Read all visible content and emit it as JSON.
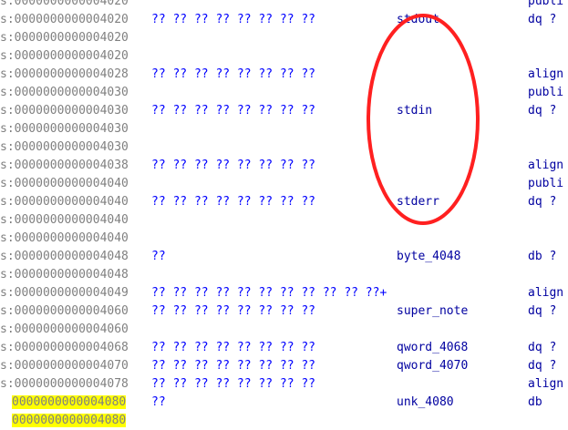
{
  "rows": [
    {
      "seg": "s",
      "addr": "0000000000004020",
      "bytes": "",
      "label": "",
      "type": "publi",
      "operand": ""
    },
    {
      "seg": "s",
      "addr": "0000000000004020",
      "bytes": "?? ?? ?? ?? ?? ?? ?? ??",
      "label": "stdout",
      "type": "dq",
      "operand": "?"
    },
    {
      "seg": "s",
      "addr": "0000000000004020",
      "bytes": "",
      "label": "",
      "type": "",
      "operand": ""
    },
    {
      "seg": "s",
      "addr": "0000000000004020",
      "bytes": "",
      "label": "",
      "type": "",
      "operand": ""
    },
    {
      "seg": "s",
      "addr": "0000000000004028",
      "bytes": "?? ?? ?? ?? ?? ?? ?? ??",
      "label": "",
      "type": "align",
      "operand": ""
    },
    {
      "seg": "s",
      "addr": "0000000000004030",
      "bytes": "",
      "label": "",
      "type": "publi",
      "operand": ""
    },
    {
      "seg": "s",
      "addr": "0000000000004030",
      "bytes": "?? ?? ?? ?? ?? ?? ?? ??",
      "label": "stdin",
      "type": "dq",
      "operand": "?"
    },
    {
      "seg": "s",
      "addr": "0000000000004030",
      "bytes": "",
      "label": "",
      "type": "",
      "operand": ""
    },
    {
      "seg": "s",
      "addr": "0000000000004030",
      "bytes": "",
      "label": "",
      "type": "",
      "operand": ""
    },
    {
      "seg": "s",
      "addr": "0000000000004038",
      "bytes": "?? ?? ?? ?? ?? ?? ?? ??",
      "label": "",
      "type": "align",
      "operand": ""
    },
    {
      "seg": "s",
      "addr": "0000000000004040",
      "bytes": "",
      "label": "",
      "type": "publi",
      "operand": ""
    },
    {
      "seg": "s",
      "addr": "0000000000004040",
      "bytes": "?? ?? ?? ?? ?? ?? ?? ??",
      "label": "stderr",
      "type": "dq",
      "operand": "?"
    },
    {
      "seg": "s",
      "addr": "0000000000004040",
      "bytes": "",
      "label": "",
      "type": "",
      "operand": ""
    },
    {
      "seg": "s",
      "addr": "0000000000004040",
      "bytes": "",
      "label": "",
      "type": "",
      "operand": ""
    },
    {
      "seg": "s",
      "addr": "0000000000004048",
      "bytes": "??",
      "label": "byte_4048",
      "type": "db",
      "operand": "?"
    },
    {
      "seg": "s",
      "addr": "0000000000004048",
      "bytes": "",
      "label": "",
      "type": "",
      "operand": ""
    },
    {
      "seg": "s",
      "addr": "0000000000004049",
      "bytes": "?? ?? ?? ?? ?? ?? ?? ?? ?? ?? ??+",
      "label": "",
      "type": "align",
      "operand": ""
    },
    {
      "seg": "s",
      "addr": "0000000000004060",
      "bytes": "?? ?? ?? ?? ?? ?? ?? ??",
      "label": "super_note",
      "type": "dq",
      "operand": "?"
    },
    {
      "seg": "s",
      "addr": "0000000000004060",
      "bytes": "",
      "label": "",
      "type": "",
      "operand": ""
    },
    {
      "seg": "s",
      "addr": "0000000000004068",
      "bytes": "?? ?? ?? ?? ?? ?? ?? ??",
      "label": "qword_4068",
      "type": "dq",
      "operand": "?"
    },
    {
      "seg": "s",
      "addr": "0000000000004070",
      "bytes": "?? ?? ?? ?? ?? ?? ?? ??",
      "label": "qword_4070",
      "type": "dq",
      "operand": "?"
    },
    {
      "seg": "s",
      "addr": "0000000000004078",
      "bytes": "?? ?? ?? ?? ?? ?? ?? ??",
      "label": "",
      "type": "align",
      "operand": ""
    },
    {
      "seg": "",
      "addr": "0000000000004080",
      "bytes": "??",
      "label": "unk_4080",
      "type": "db",
      "operand": "",
      "highlight": true
    },
    {
      "seg": "",
      "addr": "0000000000004080",
      "bytes": "",
      "label": "",
      "type": "",
      "operand": "",
      "highlight": true
    }
  ],
  "annotation_color": "#ff2020"
}
